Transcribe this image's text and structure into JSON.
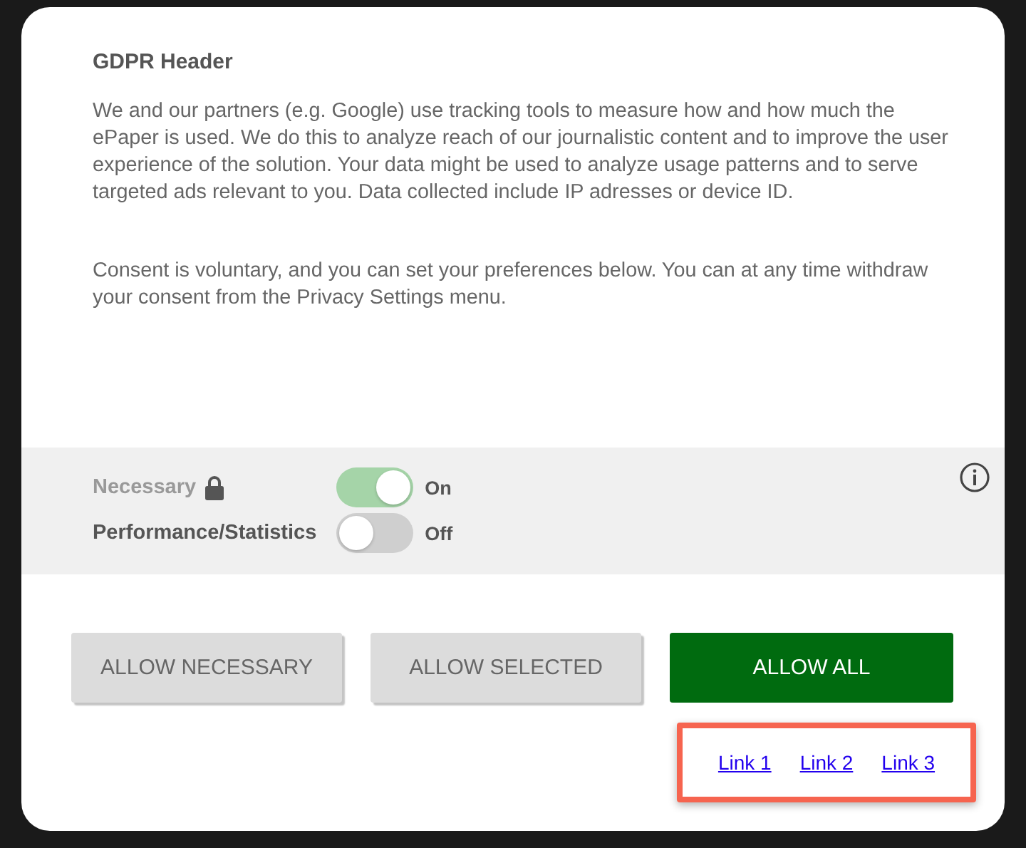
{
  "dialog": {
    "title": "GDPR Header",
    "paragraphs": [
      "We and our partners (e.g. Google) use tracking tools to measure how and how much the ePaper is used. We do this to analyze reach of our journalistic content and to improve the user experience of the solution. Your data might be used to analyze usage patterns and to serve targeted ads relevant to you. Data collected include IP adresses or device ID.",
      "Consent is voluntary, and you can set your preferences below. You can at any time withdraw your consent from the Privacy Settings menu."
    ],
    "preferences": [
      {
        "label": "Necessary",
        "disabled": true,
        "locked": true,
        "on": true,
        "state_label": "On"
      },
      {
        "label": "Performance/Statistics",
        "disabled": false,
        "locked": false,
        "on": false,
        "state_label": "Off"
      }
    ],
    "buttons": [
      {
        "label": "ALLOW NECESSARY",
        "kind": "secondary"
      },
      {
        "label": "ALLOW SELECTED",
        "kind": "secondary"
      },
      {
        "label": "ALLOW ALL",
        "kind": "primary"
      }
    ],
    "links": {
      "highlighted": true,
      "items": [
        "Link 1",
        "Link 2",
        "Link 3"
      ]
    }
  }
}
